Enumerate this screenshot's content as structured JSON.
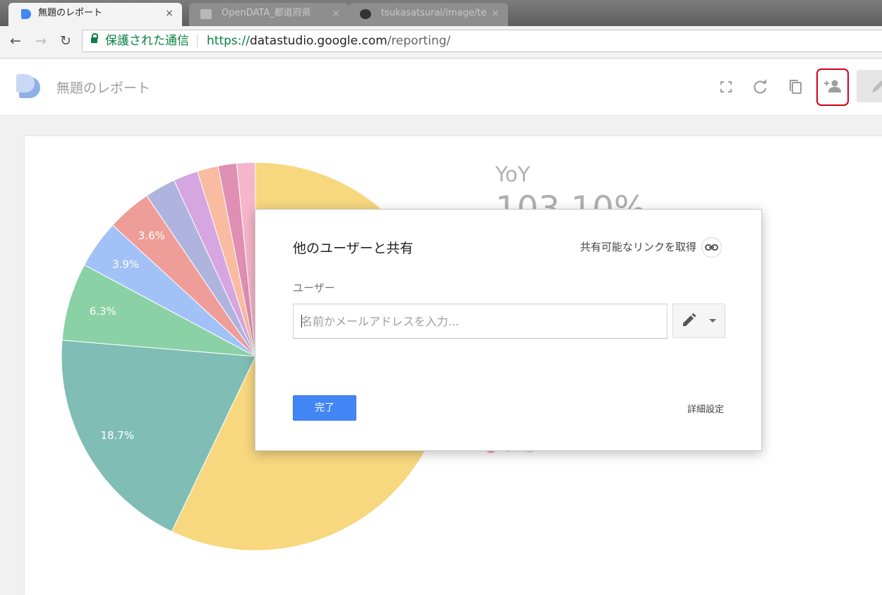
{
  "browser": {
    "tabs": [
      {
        "title": "無題のレポート",
        "close": "×",
        "active": true
      },
      {
        "title": "OpenDATA_都道府県",
        "close": "×",
        "active": false
      },
      {
        "title": "tsukasatsurai/image/te",
        "close": "×",
        "active": false
      }
    ],
    "nav": {
      "back": "←",
      "forward": "→",
      "reload": "↻"
    },
    "secure_label": "保護された通信",
    "url_scheme": "https://",
    "url_host": "datastudio.google.com",
    "url_path": "/reporting/"
  },
  "app": {
    "report_title": "無題のレポート"
  },
  "scorecard": {
    "label": "YoY",
    "value": "103.10%"
  },
  "legend_peek": "その他",
  "chart_data": {
    "type": "pie",
    "title": "",
    "slices": [
      {
        "value": 55.5,
        "label": "",
        "color": "#f7d87f"
      },
      {
        "value": 18.7,
        "label": "18.7%",
        "color": "#80bdb4"
      },
      {
        "value": 6.3,
        "label": "6.3%",
        "color": "#8ad1a6"
      },
      {
        "value": 3.9,
        "label": "3.9%",
        "color": "#a2c1f7"
      },
      {
        "value": 3.6,
        "label": "3.6%",
        "color": "#ee9d98"
      },
      {
        "value": 2.5,
        "label": "",
        "color": "#aeb4de"
      },
      {
        "value": 2.0,
        "label": "",
        "color": "#d6a6e1"
      },
      {
        "value": 1.7,
        "label": "",
        "color": "#f9bba1"
      },
      {
        "value": 1.5,
        "label": "",
        "color": "#df8fb3"
      },
      {
        "value": 1.5,
        "label": "",
        "color": "#f6b6ca"
      }
    ]
  },
  "dialog": {
    "title": "他のユーザーと共有",
    "share_link": "共有可能なリンクを取得",
    "users_label": "ユーザー",
    "input_placeholder": "名前かメールアドレスを入力...",
    "input_value": "",
    "done_label": "完了",
    "advanced_label": "詳細設定"
  },
  "colors": {
    "accent": "#4285f4",
    "secure_green": "#0b8043",
    "highlight_red": "#d0021b"
  },
  "icons": {
    "fullscreen": "fullscreen-icon",
    "refresh": "refresh-icon",
    "copy": "copy-icon",
    "share": "person-add-icon",
    "edit": "pencil-icon",
    "link": "link-icon"
  }
}
